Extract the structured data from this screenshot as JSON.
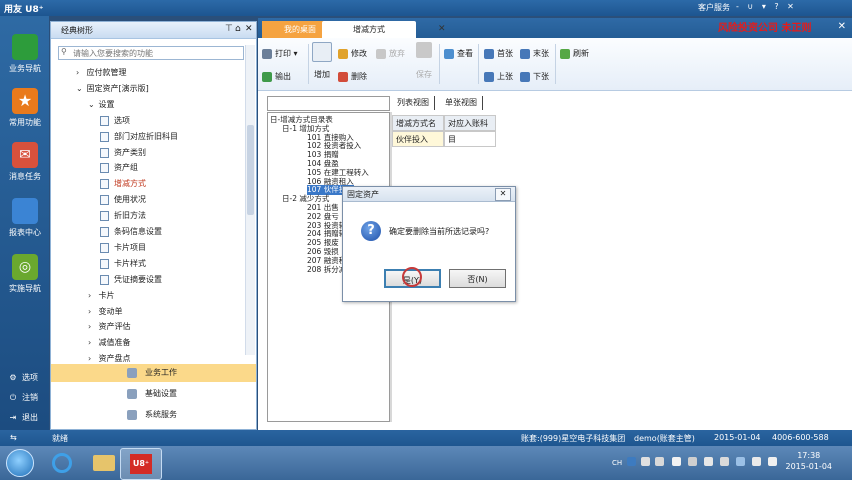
{
  "window": {
    "app_name": "用友 U8⁺",
    "customer_service": "客户服务",
    "title_controls": "- ∪ ▾ ? ✕",
    "tab_close_all": "✕"
  },
  "leftnav": {
    "items": [
      {
        "label": "业务导航",
        "color": "#2d9c3b",
        "icon": "business-nav-icon"
      },
      {
        "label": "常用功能",
        "color": "#e97a1c",
        "icon": "star-icon"
      },
      {
        "label": "消息任务",
        "color": "#d8513c",
        "icon": "mail-icon"
      },
      {
        "label": "报表中心",
        "color": "#3b84d4",
        "icon": "report-icon"
      },
      {
        "label": "实施导航",
        "color": "#6aa82e",
        "icon": "compass-icon"
      }
    ],
    "bottom": [
      {
        "label": "选项",
        "glyph": "⚙"
      },
      {
        "label": "注销",
        "glyph": "⏻"
      },
      {
        "label": "退出",
        "glyph": "⇥"
      }
    ],
    "collapse_glyph": "⇆"
  },
  "tree": {
    "header": "经典树形",
    "pin_glyph": "⊤",
    "home_glyph": "⌂",
    "close_glyph": "✕",
    "search_placeholder": "请输入您要搜索的功能",
    "nodes": [
      {
        "label": "应付款管理",
        "arrow": "›",
        "type": "folder"
      },
      {
        "label": "固定资产[演示版]",
        "arrow": "⌄",
        "type": "folder"
      },
      {
        "label": "设置",
        "arrow": "⌄",
        "type": "folder"
      },
      {
        "label": "选项",
        "type": "doc"
      },
      {
        "label": "部门对应折旧科目",
        "type": "doc"
      },
      {
        "label": "资产类别",
        "type": "doc"
      },
      {
        "label": "资产组",
        "type": "doc"
      },
      {
        "label": "增减方式",
        "type": "doc",
        "selected": true
      },
      {
        "label": "使用状况",
        "type": "doc"
      },
      {
        "label": "折旧方法",
        "type": "doc"
      },
      {
        "label": "条码信息设置",
        "type": "doc"
      },
      {
        "label": "卡片项目",
        "type": "doc"
      },
      {
        "label": "卡片样式",
        "type": "doc"
      },
      {
        "label": "凭证摘要设置",
        "type": "doc"
      },
      {
        "label": "卡片",
        "arrow": "›",
        "type": "folder"
      },
      {
        "label": "变动单",
        "arrow": "›",
        "type": "folder"
      },
      {
        "label": "资产评估",
        "arrow": "›",
        "type": "folder"
      },
      {
        "label": "减值准备",
        "arrow": "›",
        "type": "folder"
      },
      {
        "label": "资产盘点",
        "arrow": "›",
        "type": "folder"
      }
    ],
    "modules": [
      "业务工作",
      "基础设置",
      "系统服务"
    ]
  },
  "tabs": [
    {
      "label": "我的桌面"
    },
    {
      "label": "增减方式",
      "close": "✕"
    }
  ],
  "toolbar": {
    "print": "打印",
    "export": "输出",
    "add": "增加",
    "modify": "修改",
    "delete": "删除",
    "discard": "放弃",
    "save": "保存",
    "view": "查看",
    "first": "首张",
    "prev": "上张",
    "last": "末张",
    "next": "下张",
    "refresh": "刷新",
    "dropdown": "▾"
  },
  "listpane": {
    "lines": [
      "日-增减方式目录表",
      "日-1  增加方式",
      "101  直接购入",
      "102  投资者投入",
      "103  捐赠",
      "104  盘盈",
      "105  在建工程转入",
      "106  融资租入",
      "107  伙伴投入",
      "日-2  减少方式",
      "201  出售",
      "202  盘亏",
      "203  投资转出",
      "204  捐赠转出",
      "205  报废",
      "206  毁损",
      "207  融资租出",
      "208  拆分减少"
    ]
  },
  "viewtabs": [
    "列表视图",
    "单张视图"
  ],
  "grid": {
    "headers": [
      "增减方式名称",
      "对应入账科目"
    ],
    "rows": [
      [
        "伙伴投入",
        ""
      ]
    ]
  },
  "dialog": {
    "title": "固定资产",
    "message": "确定要删除当前所选记录吗?",
    "yes": "是(Y)",
    "no": "否(N)",
    "icon_glyph": "?",
    "close_glyph": "✕"
  },
  "status": {
    "left": "就绪",
    "account": "账套:(999)星空电子科技集团",
    "user": "demo(账套主管)",
    "date": "2015-01-04",
    "phone": "4006-600-588"
  },
  "taskbar": {
    "tray_lang": "CH",
    "time": "17:38",
    "date": "2015-01-04"
  },
  "overlay": {
    "red_text": "风险投资公司 未正则"
  }
}
